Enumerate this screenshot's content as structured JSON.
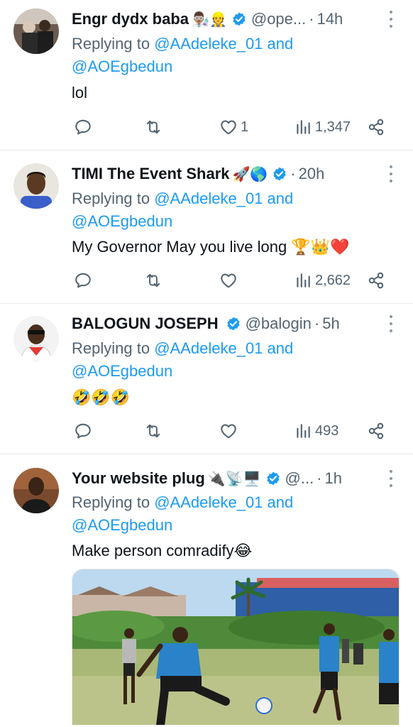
{
  "tweets": [
    {
      "name": "Engr dydx baba",
      "emojis": "👨🏽‍🔬👷",
      "verified": true,
      "handle": "@ope...",
      "time": "14h",
      "reply_prefix": "Replying to",
      "reply_user1": "@AAdeleke_01",
      "reply_and": "and",
      "reply_user2": "@AOEgbedun",
      "text": "lol",
      "likes": "1",
      "views": "1,347"
    },
    {
      "name": "TIMI The Event Shark",
      "emojis": "🚀🌎",
      "verified": true,
      "handle": "",
      "time": "20h",
      "reply_prefix": "Replying to",
      "reply_user1": "@AAdeleke_01",
      "reply_and": "and",
      "reply_user2": "@AOEgbedun",
      "text": "My Governor May you live long 🏆👑❤️",
      "likes": "",
      "views": "2,662"
    },
    {
      "name": "BALOGUN JOSEPH",
      "emojis": "",
      "verified": true,
      "handle": "@balogin",
      "time": "5h",
      "reply_prefix": "Replying to",
      "reply_user1": "@AAdeleke_01",
      "reply_and": "and",
      "reply_user2": "@AOEgbedun",
      "text": "🤣🤣🤣",
      "likes": "",
      "views": "493"
    },
    {
      "name": "Your website plug",
      "emojis": "🔌📡🖥️",
      "verified": true,
      "handle": "@...",
      "time": "1h",
      "reply_prefix": "Replying to",
      "reply_user1": "@AAdeleke_01",
      "reply_and": "and",
      "reply_user2": "@AOEgbedun",
      "text": "Make person comradify😂",
      "likes": "",
      "views": ""
    }
  ],
  "icons": {
    "reply": "reply-icon",
    "retweet": "retweet-icon",
    "like": "heart-icon",
    "views": "views-icon",
    "share": "share-icon",
    "verified": "verified-badge-icon",
    "more": "more-options-icon"
  },
  "colors": {
    "mention": "#1d9bf0",
    "verified": "#1d9bf0",
    "secondary_text": "#536471",
    "divider": "#e6e9eb"
  }
}
